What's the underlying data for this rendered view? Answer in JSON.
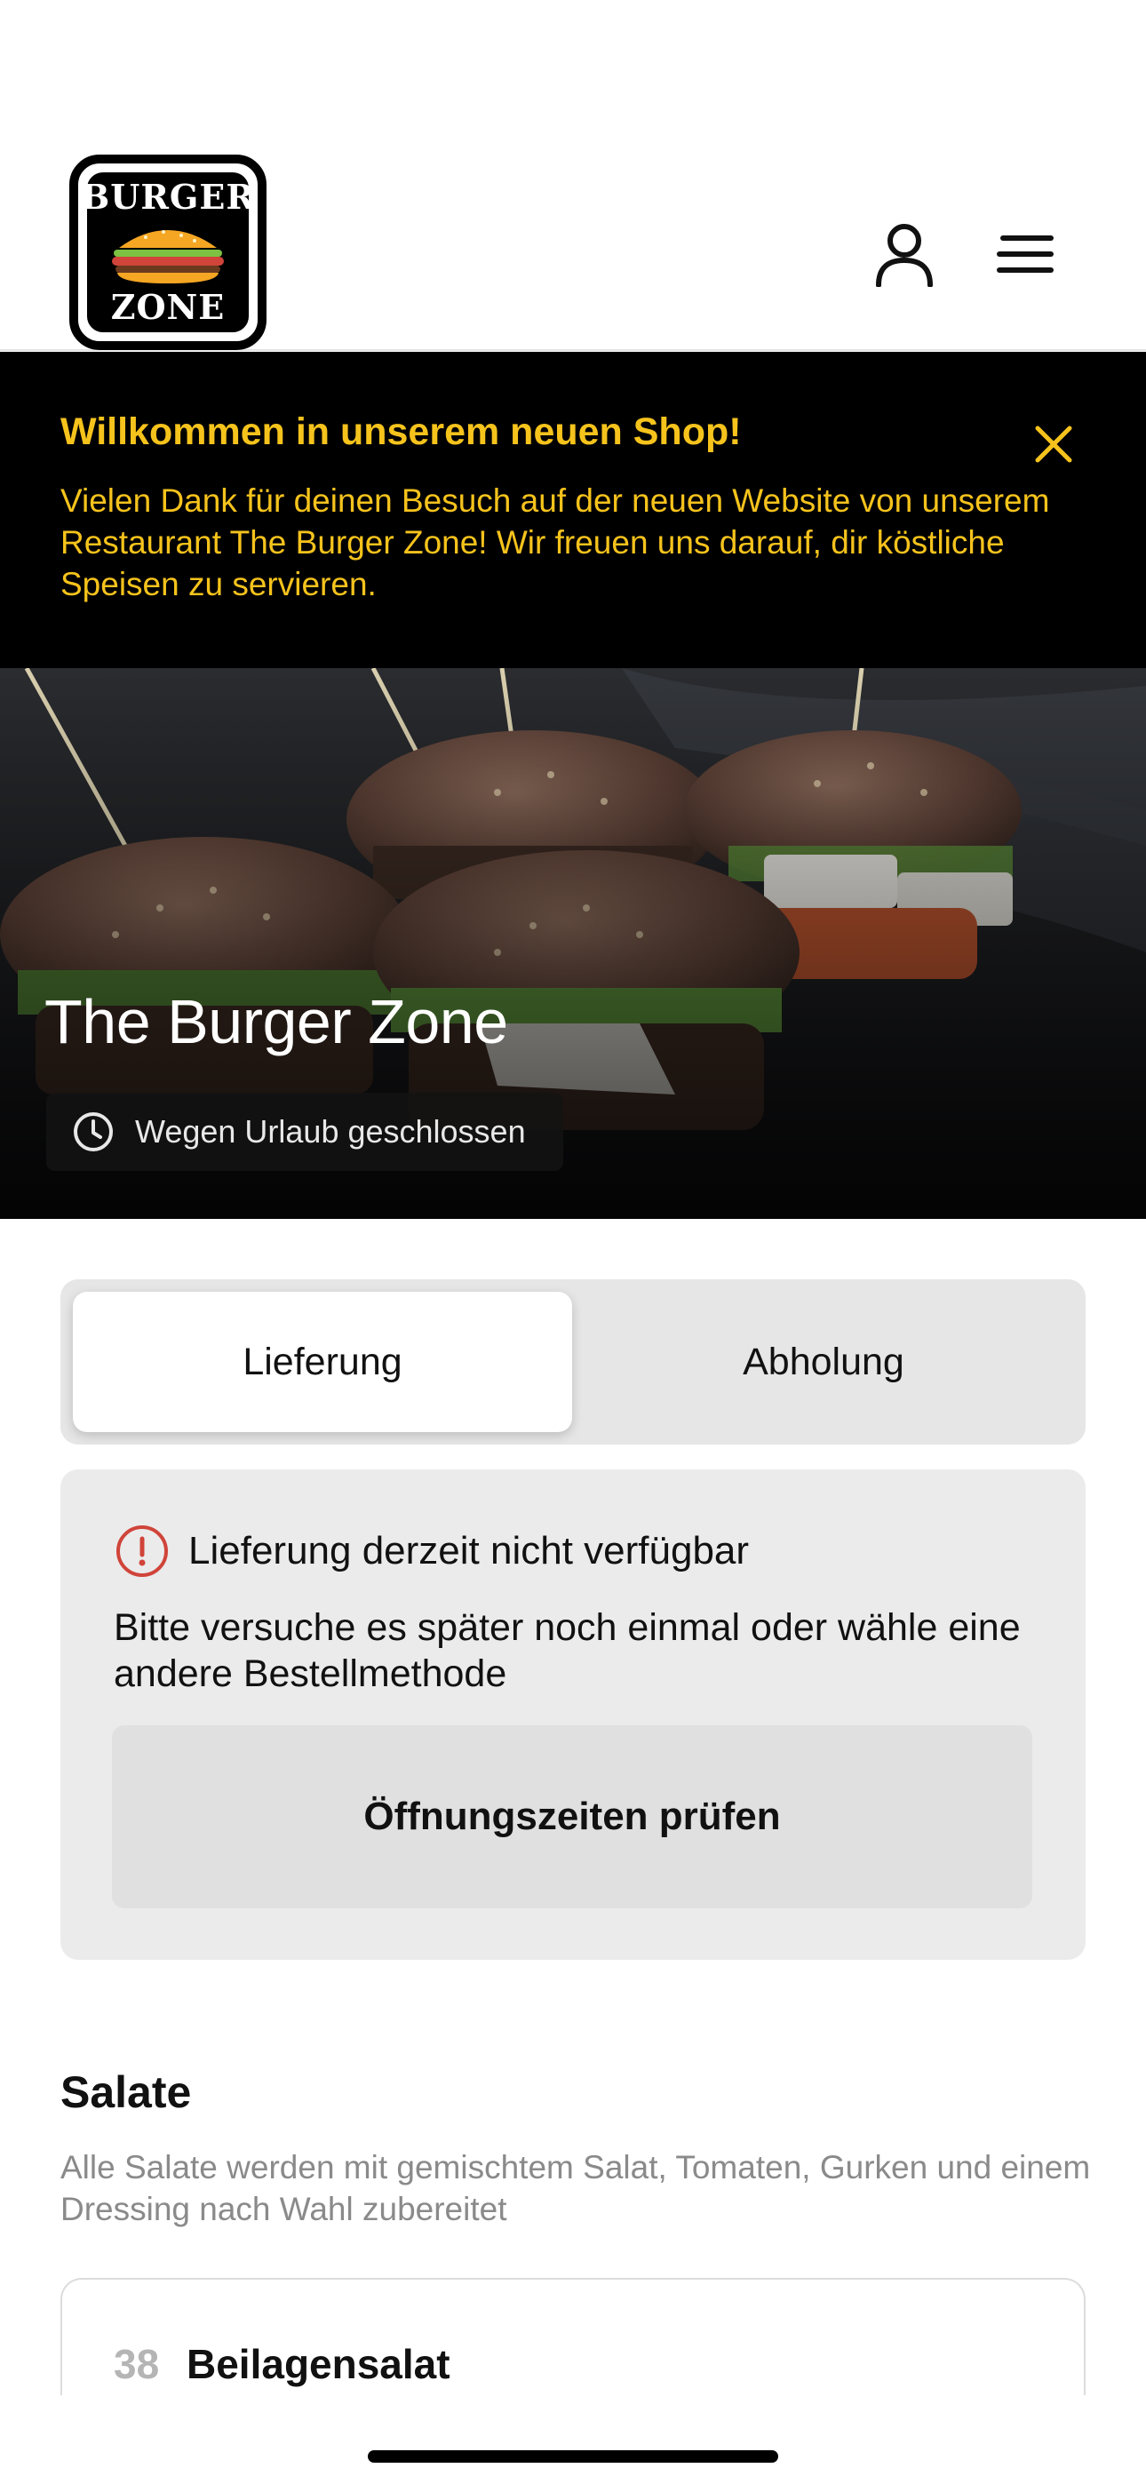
{
  "header": {
    "logo_line1": "BURGER",
    "logo_line2": "ZONE",
    "user_icon": "user-icon",
    "menu_icon": "hamburger-menu-icon"
  },
  "banner": {
    "title": "Willkommen in unserem neuen Shop!",
    "text": "Vielen Dank für deinen Besuch auf der neuen Website von unserem Restaurant The Burger Zone! Wir freuen uns darauf, dir köstliche Speisen zu servieren.",
    "close_icon": "close-icon",
    "text_color": "#f6c31c"
  },
  "hero": {
    "title": "The Burger Zone",
    "status": "Wegen Urlaub geschlossen",
    "status_icon": "clock-icon"
  },
  "order_mode": {
    "options": [
      "Lieferung",
      "Abholung"
    ],
    "selected": "Lieferung"
  },
  "notice": {
    "icon": "info-circle-icon",
    "icon_color": "#d0443a",
    "title": "Lieferung derzeit nicht verfügbar",
    "text": "Bitte versuche es später noch einmal oder wähle eine andere Bestellmethode",
    "button": "Öffnungszeiten prüfen"
  },
  "menu_section": {
    "title": "Salate",
    "description": "Alle Salate werden mit gemischtem Salat, Tomaten, Gurken und einem Dressing nach Wahl zubereitet",
    "items": [
      {
        "number": "38",
        "name": "Beilagensalat"
      }
    ]
  }
}
